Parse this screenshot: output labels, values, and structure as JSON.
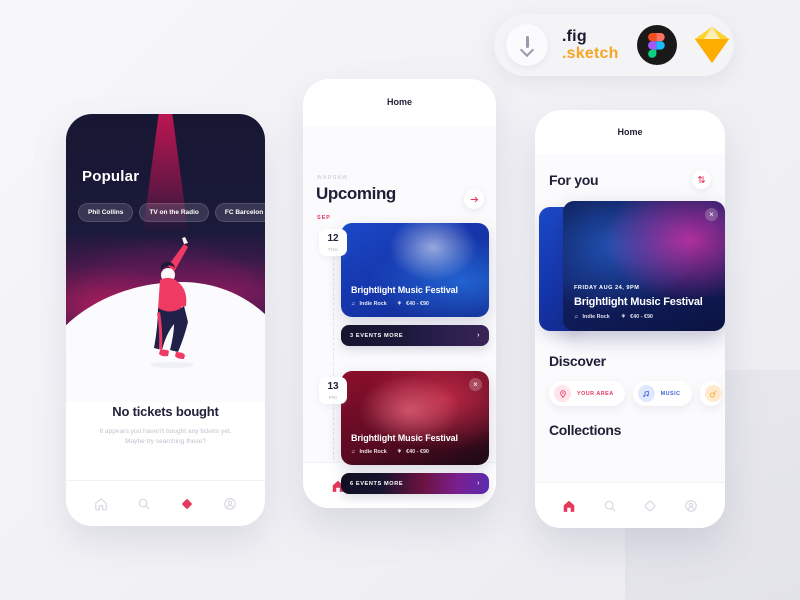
{
  "download_badge": {
    "icon": "download-arrow-icon",
    "fig_label": ".fig",
    "sketch_label": ".sketch",
    "figma_icon": "figma-logo-icon",
    "sketch_icon": "sketch-diamond-icon",
    "fig_color": "#1a1a2e",
    "sketch_color": "#f5a623"
  },
  "accent_color": "#e8375d",
  "screen1": {
    "hero": {
      "title": "Popular",
      "chips": [
        "Phil Collins",
        "TV on the Radio",
        "FC Barcelon"
      ]
    },
    "empty_state": {
      "title": "No tickets bought",
      "subtitle": "It appears you haven't bought any tickets yet. Maybe try searching these?"
    },
    "nav": [
      {
        "icon": "home-icon",
        "active": false
      },
      {
        "icon": "search-icon",
        "active": false
      },
      {
        "icon": "diamond-ticket-icon",
        "active": true
      },
      {
        "icon": "profile-icon",
        "active": false
      }
    ]
  },
  "screen2": {
    "header_title": "Home",
    "location": "WARSAW",
    "section_title": "Upcoming",
    "next_arrow_icon": "arrow-right-icon",
    "month": "SEP",
    "events": [
      {
        "day": "12",
        "weekday": "THU",
        "name": "Brightlight Music Festival",
        "genre": "Indie Rock",
        "price": "€40 - €90",
        "genre_icon": "music-note-icon",
        "price_icon": "ticket-icon",
        "more_label": "3 EVENTS MORE",
        "has_close": false
      },
      {
        "day": "13",
        "weekday": "FRI",
        "name": "Brightlight Music Festival",
        "genre": "Indie Rock",
        "price": "€40 - €90",
        "genre_icon": "music-note-icon",
        "price_icon": "ticket-icon",
        "more_label": "6 EVENTS MORE",
        "has_close": true
      }
    ],
    "nav": [
      {
        "icon": "home-icon",
        "active": true
      },
      {
        "icon": "search-icon",
        "active": false
      },
      {
        "icon": "diamond-ticket-icon",
        "active": false
      },
      {
        "icon": "profile-icon",
        "active": false
      }
    ]
  },
  "screen3": {
    "header_title": "Home",
    "for_you": {
      "title": "For you",
      "sort_icon": "sort-arrows-icon",
      "card": {
        "date": "FRIDAY AUG 24, 9PM",
        "name": "Brightlight Music Festival",
        "genre": "Indie Rock",
        "price": "€40 - €90",
        "genre_icon": "music-note-icon",
        "price_icon": "ticket-icon",
        "close_icon": "close-icon"
      }
    },
    "discover": {
      "title": "Discover",
      "chips": [
        {
          "label": "YOUR AREA",
          "icon": "location-pin-icon",
          "color": "#e8375d"
        },
        {
          "label": "MUSIC",
          "icon": "music-note-icon",
          "color": "#3b63d8"
        },
        {
          "label": "",
          "icon": "guitar-icon",
          "color": "#f5a623"
        }
      ]
    },
    "collections": {
      "title": "Collections"
    },
    "nav": [
      {
        "icon": "home-icon",
        "active": true
      },
      {
        "icon": "search-icon",
        "active": false
      },
      {
        "icon": "diamond-ticket-icon",
        "active": false
      },
      {
        "icon": "profile-icon",
        "active": false
      }
    ]
  }
}
